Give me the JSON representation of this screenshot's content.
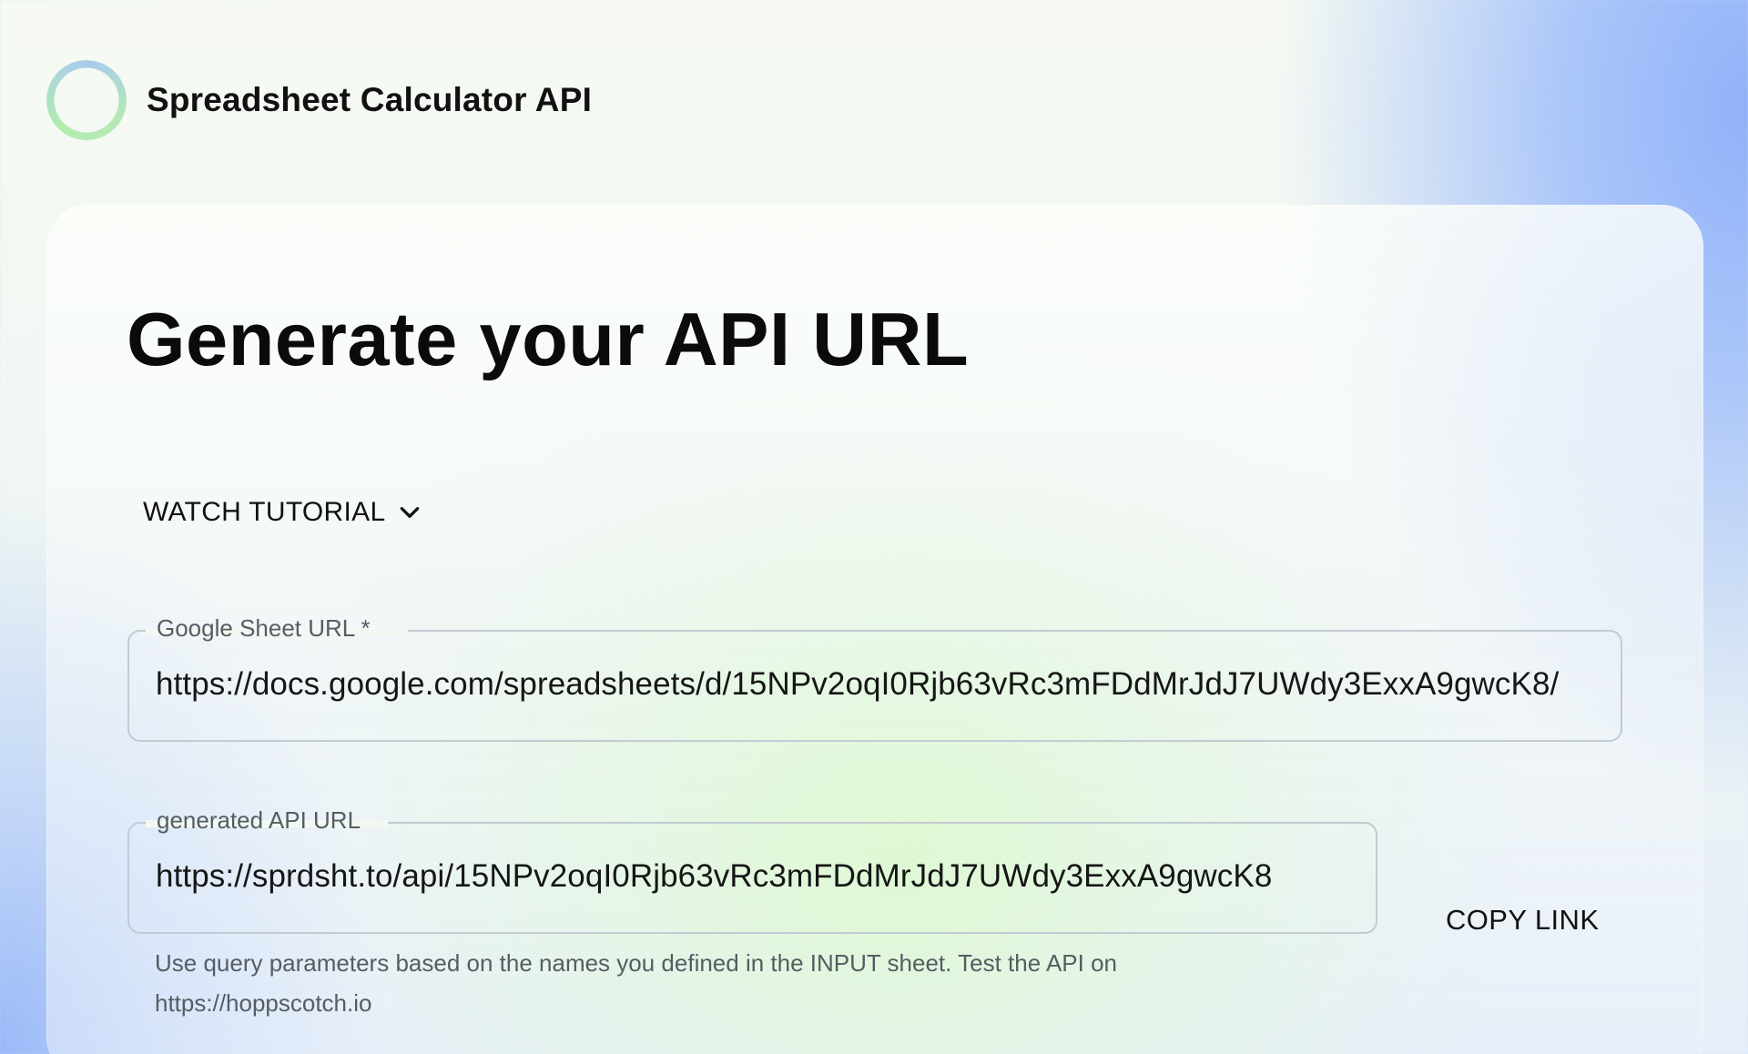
{
  "header": {
    "app_title": "Spreadsheet Calculator API",
    "logo_icon": "ring-logo-icon"
  },
  "main": {
    "headline": "Generate your API URL",
    "tutorial": {
      "label": "WATCH TUTORIAL",
      "icon": "chevron-down-icon"
    },
    "sheet_field": {
      "label": "Google Sheet URL *",
      "value": "https://docs.google.com/spreadsheets/d/15NPv2oqI0Rjb63vRc3mFDdMrJdJ7UWdy3ExxA9gwcK8/"
    },
    "api_field": {
      "label": "generated API URL",
      "value": "https://sprdsht.to/api/15NPv2oqI0Rjb63vRc3mFDdMrJdJ7UWdy3ExxA9gwcK8"
    },
    "copy_link_label": "COPY LINK",
    "helper_line1": "Use query parameters based on the names you defined in the INPUT sheet. Test the API on",
    "helper_line2": "https://hoppscotch.io"
  },
  "colors": {
    "accent_blue": "#8eb0fa",
    "accent_green": "#d6f8c8",
    "border": "#c3cbd2",
    "text": "#111111",
    "muted_text": "#555d63"
  }
}
